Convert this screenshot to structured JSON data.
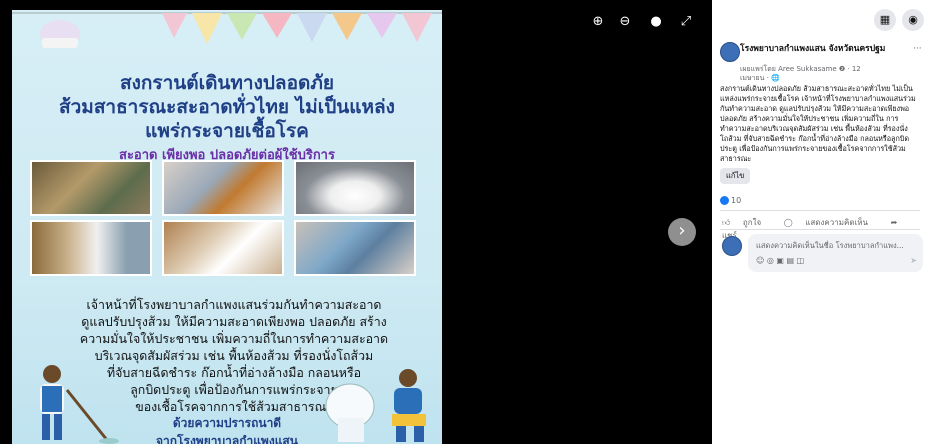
{
  "poster": {
    "title_line1": "สงกรานต์เดินทางปลอดภัย",
    "title_line2": "ส้วมสาธารณะสะอาดทั่วไทย ไม่เป็นแหล่ง",
    "title_line3": "แพร่กระจายเชื้อโรค",
    "subtitle": "สะอาด เพียงพอ ปลอดภัยต่อผู้ใช้บริการ",
    "body_line1": "เจ้าหน้าที่โรงพยาบาลกำแพงแสนร่วมกันทำความสะอาด",
    "body_line2": "ดูแลปรับปรุงส้วม ให้มีความสะอาดเพียงพอ ปลอดภัย สร้าง",
    "body_line3": "ความมั่นใจให้ประชาชน เพิ่มความถี่ในการทำความสะอาด",
    "body_line4": "บริเวณจุดสัมผัสร่วม เช่น พื้นห้องส้วม ที่รองนั่งโถส้วม",
    "body_line5": "ที่จับสายฉีดชำระ ก๊อกน้ำที่อ่างล้างมือ กลอนหรือ",
    "body_line6": "ลูกบิดประตู เพื่อป้องกันการแพร่กระจาย",
    "body_line7": "ของเชื้อโรคจากการใช้ส้วมสาธารณะ",
    "sign_line1": "ด้วยความปรารถนาดี",
    "sign_line2": "จากโรงพยาบาลกำแพงแสน"
  },
  "viewer": {
    "zoom_in_icon": "zoom-in-icon",
    "zoom_out_icon": "zoom-out-icon",
    "tag_icon": "tag-icon",
    "fullscreen_icon": "fullscreen-icon",
    "next_icon": "chevron-right-icon"
  },
  "panel": {
    "page_name": "โรงพยาบาลกำแพงแสน จังหวัดนครปฐม",
    "meta_line1": "เผยแพร่โดย Aree Sukkasame ❷ · 12",
    "meta_line2": "เมษายน · 🌐",
    "more": "···",
    "post_text": "สงกรานต์เดินทางปลอดภัย ส้วมสาธารณะสะอาดทั่วไทย ไม่เป็นแหล่งแพร่กระจายเชื้อโรค เจ้าหน้าที่โรงพยาบาลกำแพงแสนร่วมกันทำความสะอาด ดูแลปรับปรุงส้วม ให้มีความสะอาดเพียงพอ ปลอดภัย สร้างความมั่นใจให้ประชาชน เพิ่มความถี่ใน การทำความสะอาดบริเวณจุดสัมผัสร่วม เช่น พื้นห้องส้วม ที่รองนั่งโถส้วม ที่จับสายฉีดชำระ ก๊อกน้ำที่อ่างล้างมือ กลอนหรือลูกบิดประตู เพื่อป้องกันการแพร่กระจายของเชื้อโรคจากการใช้ส้วมสาธารณะ",
    "edit_label": "แก้ไข",
    "like_count": "10",
    "like_label": "ถูกใจ",
    "comment_label": "แสดงความคิดเห็น",
    "share_label": "แชร์",
    "comment_placeholder": "แสดงความคิดเห็นในชื่อ โรงพยาบาลกำแพง...",
    "comment_icons": "☺ ◎ ▣ ▤ ◫",
    "send": "➤"
  },
  "colors": {
    "title": "#1f3f86",
    "subtitle": "#6b2fa8",
    "accent": "#1877f2"
  }
}
